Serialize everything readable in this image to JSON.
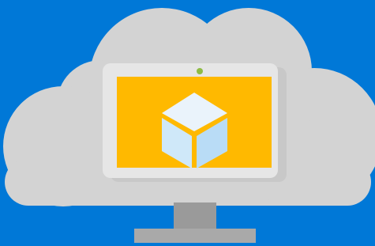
{
  "illustration": {
    "subject": "",
    "icons": {
      "cloud": "cloud-icon",
      "monitor": "monitor-icon",
      "camera": "webcam-dot-icon",
      "cube": "cube-icon"
    },
    "colors": {
      "background": "#0078d7",
      "cloud": "#d3d3d3",
      "monitor_bezel": "#e6e6e6",
      "monitor_bezel_shadow": "#c8c8c8",
      "screen": "#ffb900",
      "webcam": "#8fbc45",
      "cube_top": "#eaf3fb",
      "cube_left": "#cfe8f9",
      "cube_right": "#b9dcf6",
      "stand": "#9a9a9a",
      "base": "#a9a9a9"
    }
  }
}
